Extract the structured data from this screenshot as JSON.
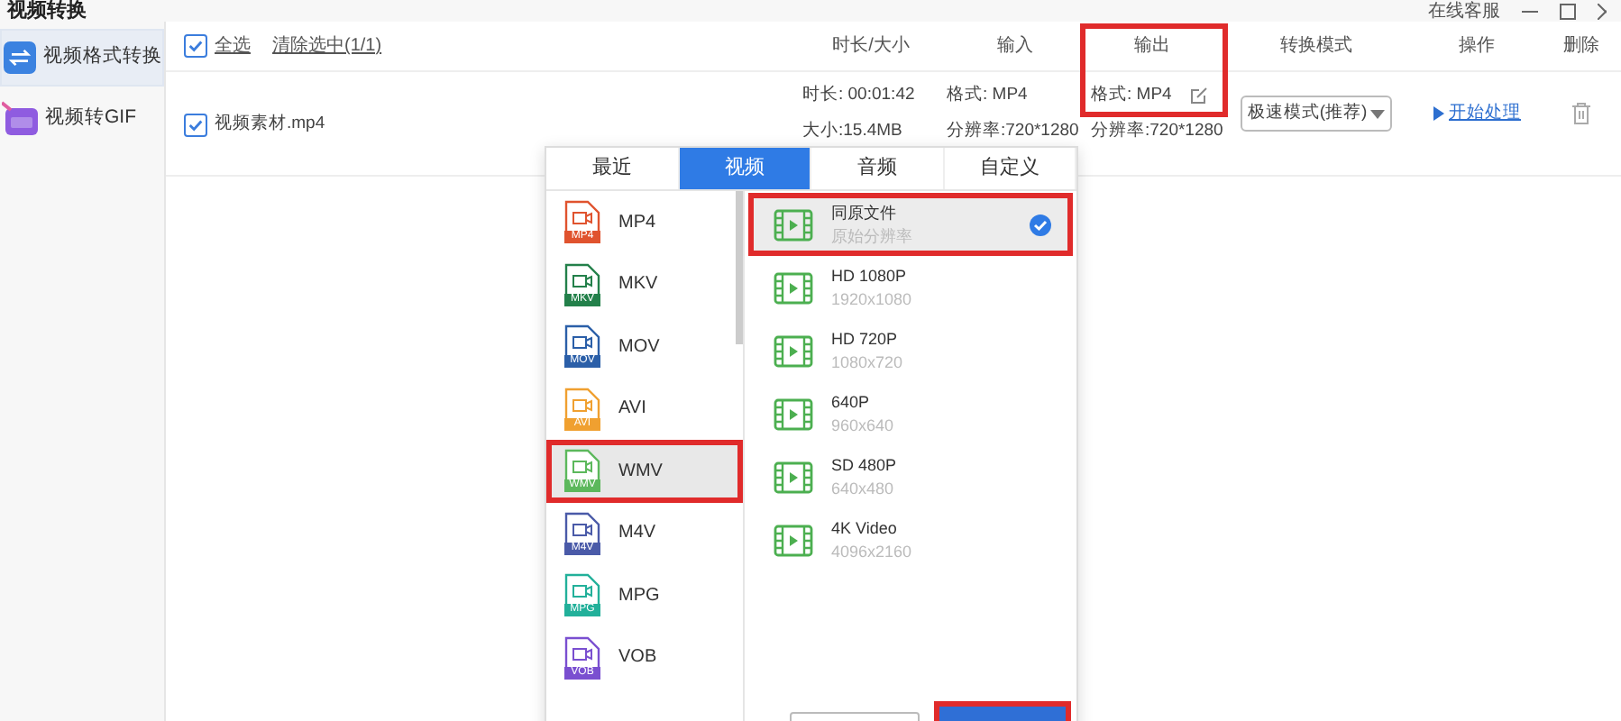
{
  "window": {
    "title": "视频转换",
    "support": "在线客服"
  },
  "sidebar": {
    "items": [
      {
        "label": "视频格式转换",
        "selected": true,
        "kind": "convert"
      },
      {
        "label": "视频转GIF",
        "selected": false,
        "kind": "gif"
      }
    ]
  },
  "toolbar": {
    "select_all": {
      "label": "全选",
      "checked": true
    },
    "clear": "清除选中(1/1)"
  },
  "table": {
    "columns": [
      "时长/大小",
      "输入",
      "输出",
      "转换模式",
      "操作",
      "删除"
    ],
    "rows": [
      {
        "checked": true,
        "name": "视频素材.mp4",
        "duration": "时长: 00:01:42",
        "size": "大小:15.4MB",
        "input_format": "格式: MP4",
        "input_resolution": "分辨率:720*1280",
        "output_format": "格式: MP4",
        "output_resolution": "分辨率:720*1280",
        "mode": "极速模式(推荐)",
        "action": "开始处理"
      }
    ]
  },
  "popup": {
    "tabs": [
      {
        "label": "最近",
        "selected": false
      },
      {
        "label": "视频",
        "selected": true
      },
      {
        "label": "音频",
        "selected": false
      },
      {
        "label": "自定义",
        "selected": false
      }
    ],
    "formats": [
      {
        "label": "MP4",
        "badge": "MP4",
        "color": "#e0532e",
        "selected": false
      },
      {
        "label": "MKV",
        "badge": "MKV",
        "color": "#23804a",
        "selected": false
      },
      {
        "label": "MOV",
        "badge": "MOV",
        "color": "#2b5fa8",
        "selected": false
      },
      {
        "label": "AVI",
        "badge": "AVI",
        "color": "#f0a030",
        "selected": false
      },
      {
        "label": "WMV",
        "badge": "WMV",
        "color": "#5cb85c",
        "selected": true
      },
      {
        "label": "M4V",
        "badge": "M4V",
        "color": "#4a5aa8",
        "selected": false
      },
      {
        "label": "MPG",
        "badge": "MPG",
        "color": "#22b09a",
        "selected": false
      },
      {
        "label": "VOB",
        "badge": "VOB",
        "color": "#7a4fd0",
        "selected": false
      }
    ],
    "presets": [
      {
        "label": "同原文件",
        "detail": "原始分辨率",
        "selected": true
      },
      {
        "label": "HD 1080P",
        "detail": "1920x1080",
        "selected": false
      },
      {
        "label": "HD 720P",
        "detail": "1080x720",
        "selected": false
      },
      {
        "label": "640P",
        "detail": "960x640",
        "selected": false
      },
      {
        "label": "SD 480P",
        "detail": "640x480",
        "selected": false
      },
      {
        "label": "4K Video",
        "detail": "4096x2160",
        "selected": false
      }
    ]
  }
}
